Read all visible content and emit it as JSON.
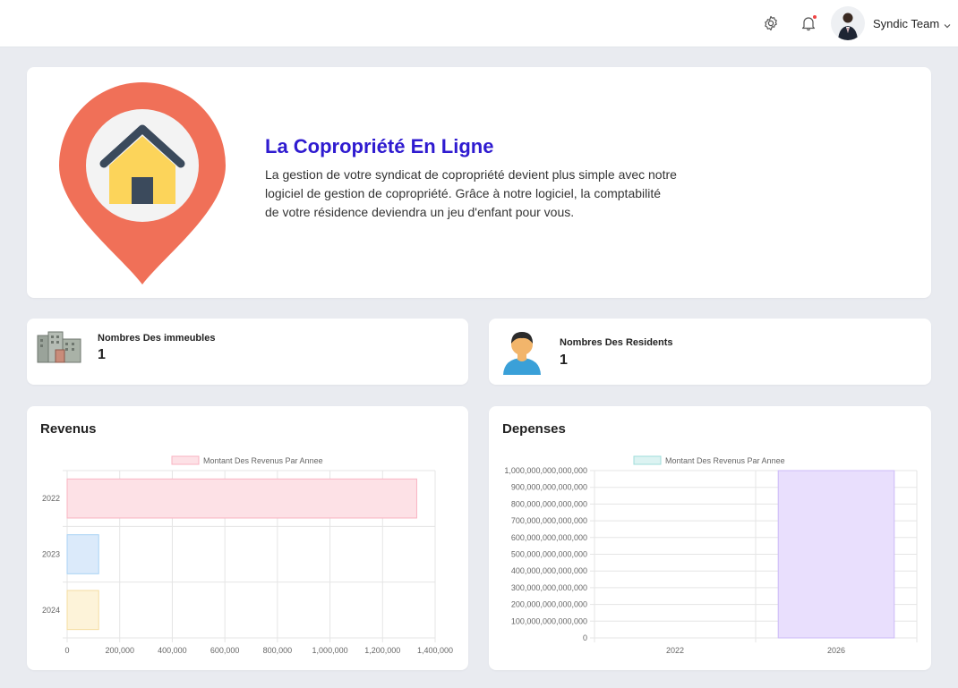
{
  "header": {
    "user_name": "Syndic Team",
    "icons": [
      "gear-icon",
      "bell-icon",
      "chevron-down-icon"
    ]
  },
  "hero": {
    "title": "La Copropriété En Ligne",
    "description": "La gestion de votre syndicat de copropriété devient plus simple avec notre logiciel de gestion de copropriété. Grâce à notre logiciel, la comptabilité de votre résidence deviendra un jeu d'enfant pour vous."
  },
  "stats": {
    "buildings": {
      "label": "Nombres Des immeubles",
      "value": "1"
    },
    "residents": {
      "label": "Nombres Des Residents",
      "value": "1"
    }
  },
  "colors": {
    "pin": "#f07058",
    "house_roof": "#3b4a5c",
    "house_wall": "#fcd45a",
    "title": "#2f1bd0"
  },
  "chart_data": [
    {
      "title": "Revenus",
      "type": "bar",
      "orientation": "horizontal",
      "legend": "Montant Des Revenus Par Annee",
      "legend_position": "top",
      "categories": [
        "2022",
        "2023",
        "2024"
      ],
      "values": [
        1330000,
        120000,
        120000
      ],
      "colors": [
        "#fde1e6",
        "#dbeafa",
        "#fdf3d9"
      ],
      "border_colors": [
        "#f9b3c2",
        "#a9d2f5",
        "#f5dca0"
      ],
      "xlim": [
        0,
        1400000
      ],
      "x_ticks": [
        "0",
        "200,000",
        "400,000",
        "600,000",
        "800,000",
        "1,000,000",
        "1,200,000",
        "1,400,000"
      ],
      "grid": true
    },
    {
      "title": "Depenses",
      "type": "bar",
      "orientation": "vertical",
      "legend": "Montant Des Revenus Par Annee",
      "legend_position": "top",
      "categories": [
        "2022",
        "2026"
      ],
      "values": [
        0,
        1000000000000000
      ],
      "colors": [
        "#dcf3f2",
        "#e9dffd"
      ],
      "border_colors": [
        "#9fdedb",
        "#cbb9f7"
      ],
      "ylim": [
        0,
        1000000000000000
      ],
      "y_ticks": [
        "0",
        "100,000,000,000,000",
        "200,000,000,000,000",
        "300,000,000,000,000",
        "400,000,000,000,000",
        "500,000,000,000,000",
        "600,000,000,000,000",
        "700,000,000,000,000",
        "800,000,000,000,000",
        "900,000,000,000,000",
        "1,000,000,000,000,000"
      ],
      "grid": true
    }
  ]
}
